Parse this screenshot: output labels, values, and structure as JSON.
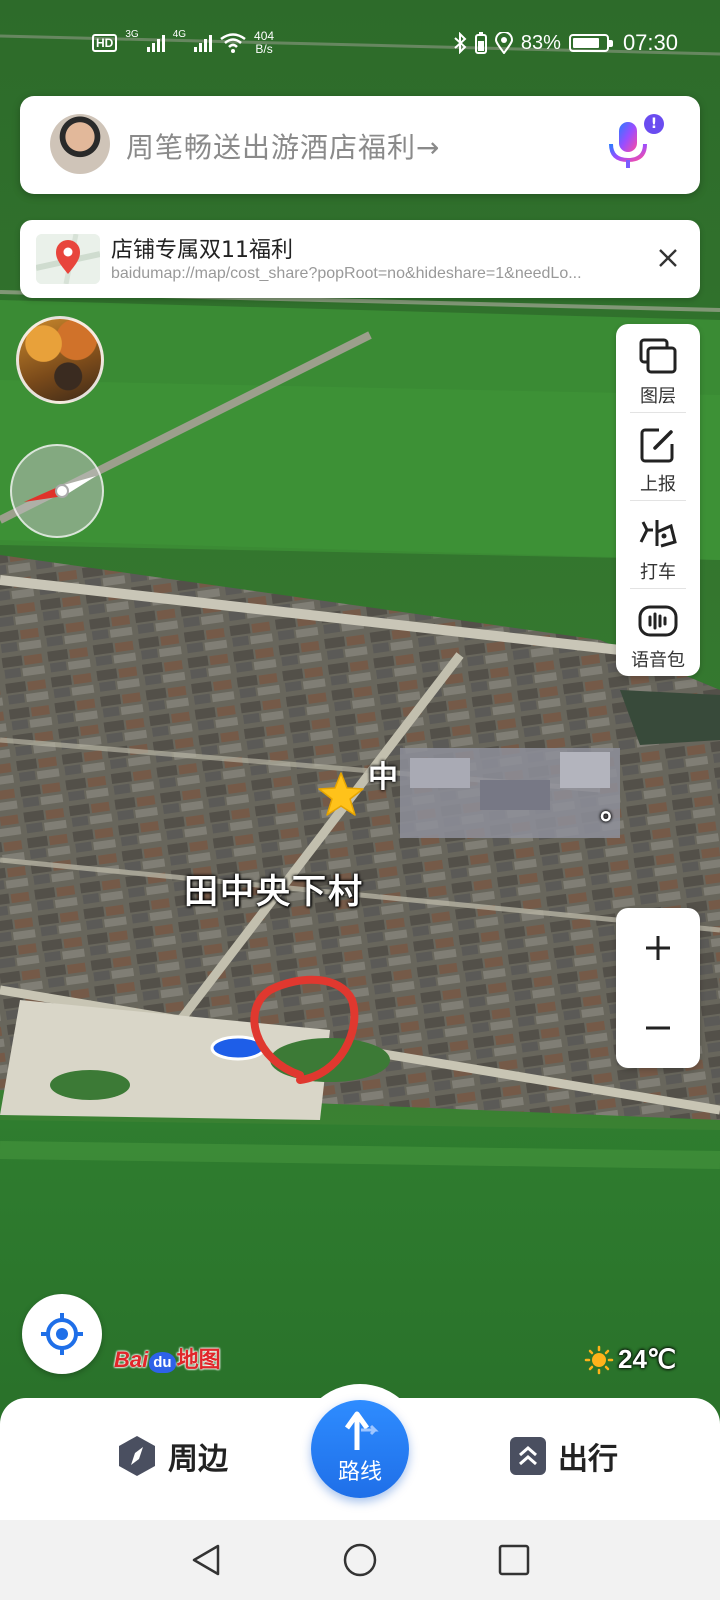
{
  "status_bar": {
    "hd": "HD",
    "net1": "3G",
    "net2": "4G",
    "speed_value": "404",
    "speed_unit": "B/s",
    "battery": "83%",
    "battery_level": 0.83,
    "time": "07:30"
  },
  "search": {
    "placeholder": "周笔畅送出游酒店福利→",
    "badge": "!"
  },
  "banner": {
    "title": "店铺专属双11福利",
    "url": "baidumap://map/cost_share?popRoot=no&hideshare=1&needLo..."
  },
  "toolbar": {
    "layers": "图层",
    "report": "上报",
    "taxi": "打车",
    "voice_pack": "语音包"
  },
  "map": {
    "poi_name_prefix": "中",
    "village": "田中央下村",
    "poi_name_suffix": "。"
  },
  "logo": {
    "bai": "Bai",
    "du": "du",
    "map": "地图"
  },
  "weather": {
    "temp": "24℃",
    "icon": "sun-icon"
  },
  "bottom_nav": {
    "nearby": "周边",
    "route": "路线",
    "travel": "出行"
  }
}
